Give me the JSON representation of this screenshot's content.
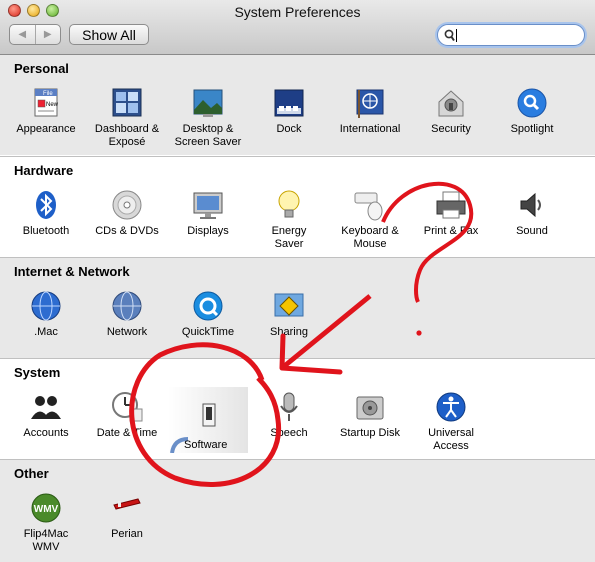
{
  "window": {
    "title": "System Preferences"
  },
  "toolbar": {
    "back_label": "◀",
    "forward_label": "▶",
    "show_all_label": "Show All",
    "search": {
      "value": "",
      "placeholder": ""
    }
  },
  "sections": [
    {
      "title": "Personal",
      "items": [
        {
          "label": "Appearance",
          "icon": "appearance-icon"
        },
        {
          "label": "Dashboard &\nExposé",
          "icon": "dashboard-expose-icon"
        },
        {
          "label": "Desktop &\nScreen Saver",
          "icon": "desktop-screensaver-icon"
        },
        {
          "label": "Dock",
          "icon": "dock-icon"
        },
        {
          "label": "International",
          "icon": "international-icon"
        },
        {
          "label": "Security",
          "icon": "security-icon"
        },
        {
          "label": "Spotlight",
          "icon": "spotlight-icon"
        }
      ]
    },
    {
      "title": "Hardware",
      "items": [
        {
          "label": "Bluetooth",
          "icon": "bluetooth-icon"
        },
        {
          "label": "CDs & DVDs",
          "icon": "cd-dvd-icon"
        },
        {
          "label": "Displays",
          "icon": "displays-icon"
        },
        {
          "label": "Energy\nSaver",
          "icon": "energy-saver-icon"
        },
        {
          "label": "Keyboard &\nMouse",
          "icon": "keyboard-mouse-icon"
        },
        {
          "label": "Print & Fax",
          "icon": "print-fax-icon"
        },
        {
          "label": "Sound",
          "icon": "sound-icon"
        }
      ]
    },
    {
      "title": "Internet & Network",
      "items": [
        {
          "label": ".Mac",
          "icon": "dotmac-icon"
        },
        {
          "label": "Network",
          "icon": "network-icon"
        },
        {
          "label": "QuickTime",
          "icon": "quicktime-icon"
        },
        {
          "label": "Sharing",
          "icon": "sharing-icon"
        }
      ]
    },
    {
      "title": "System",
      "items": [
        {
          "label": "Accounts",
          "icon": "accounts-icon"
        },
        {
          "label": "Date & Time",
          "icon": "date-time-icon"
        },
        {
          "label": "Speech",
          "icon": "speech-icon"
        },
        {
          "label": "Startup Disk",
          "icon": "startup-disk-icon"
        },
        {
          "label": "Universal\nAccess",
          "icon": "universal-access-icon"
        }
      ]
    },
    {
      "title": "Other",
      "items": [
        {
          "label": "Flip4Mac\nWMV",
          "icon": "flip4mac-icon"
        },
        {
          "label": "Perian",
          "icon": "perian-icon"
        }
      ]
    }
  ],
  "dragged_pane": {
    "label": "Software",
    "icon": "software-update-icon"
  },
  "annotation": {
    "text": "?"
  },
  "colors": {
    "annotation": "#e0141c",
    "search_focus": "#a8c4ec",
    "section_alt": "#e8e8e8"
  }
}
